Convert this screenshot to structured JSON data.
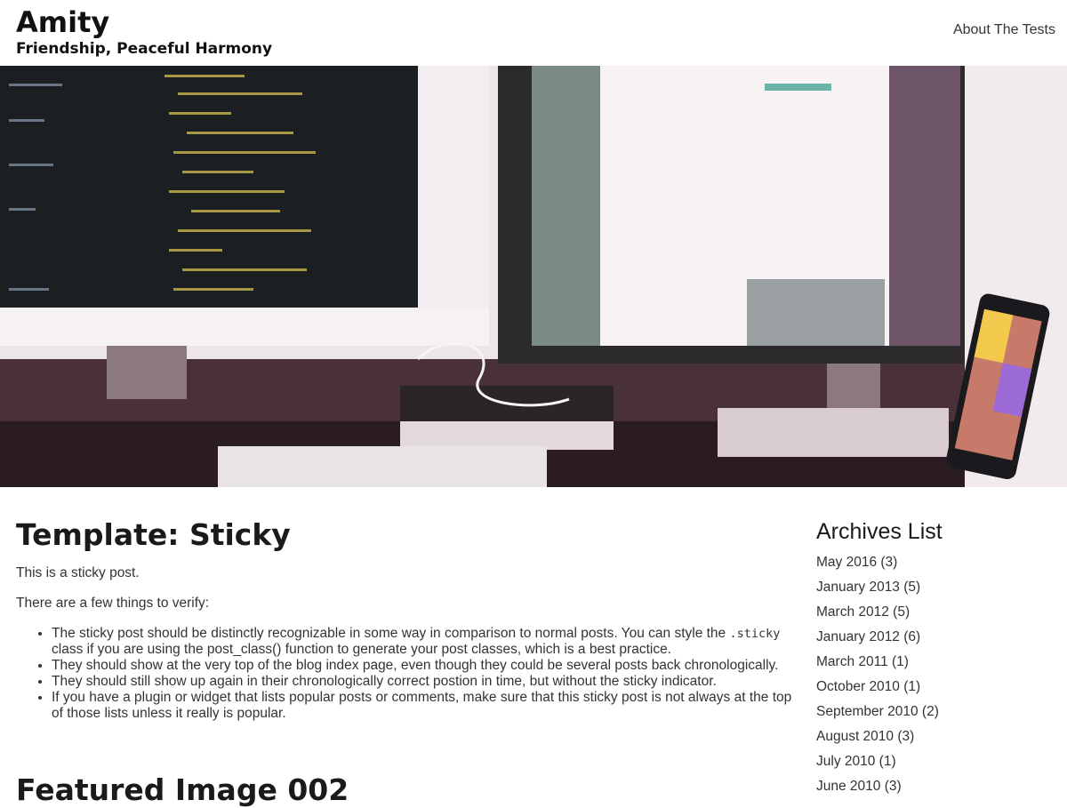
{
  "site": {
    "title": "Amity",
    "tagline": "Friendship, Peaceful Harmony"
  },
  "nav": {
    "about_link": "About The Tests"
  },
  "hero": {
    "description_icon": "hero-image",
    "colors": {
      "wall": "#efe9ec",
      "desk": "#5a3a44",
      "screen_dark": "#1d2226",
      "screen_light": "#f4eef0"
    }
  },
  "post": {
    "title": "Template: Sticky",
    "intro": "This is a sticky post.",
    "lead": "There are a few things to verify:",
    "bullets": {
      "b1_part1": "The sticky post should be distinctly recognizable in some way in comparison to normal posts. You can style the ",
      "b1_code": ".sticky",
      "b1_part2": " class if you are using the ",
      "b1_func": "post_class()",
      "b1_part3": " function to generate your post classes, which is a best practice.",
      "b2": "They should show at the very top of the blog index page, even though they could be several posts back chronologically.",
      "b3": "They should still show up again in their chronologically correct postion in time, but without the sticky indicator.",
      "b4": "If you have a plugin or widget that lists popular posts or comments, make sure that this sticky post is not always at the top of those lists unless it really is popular."
    }
  },
  "next_post": {
    "title": "Featured Image 002"
  },
  "sidebar": {
    "archives_title": "Archives List",
    "archives": [
      "May 2016 (3)",
      "January 2013 (5)",
      "March 2012 (5)",
      "January 2012 (6)",
      "March 2011 (1)",
      "October 2010 (1)",
      "September 2010 (2)",
      "August 2010 (3)",
      "July 2010 (1)",
      "June 2010 (3)"
    ]
  }
}
